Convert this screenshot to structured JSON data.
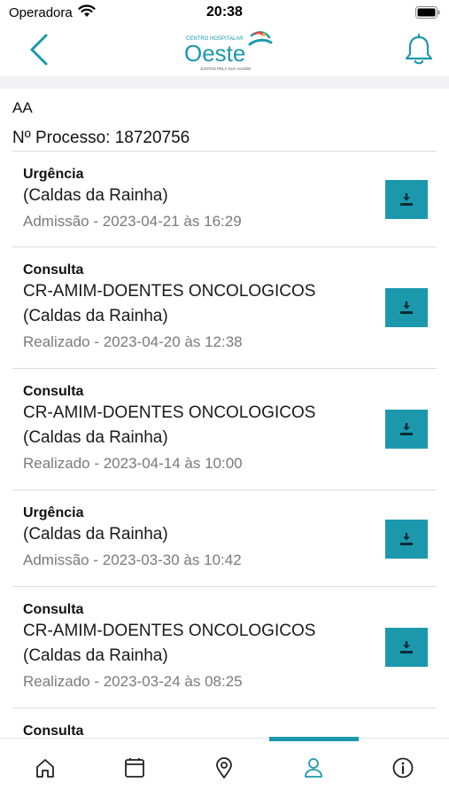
{
  "status_bar": {
    "carrier": "Operadora",
    "time": "20:38"
  },
  "header": {
    "logo": {
      "top_text": "CENTRO HOSPITALAR",
      "name": "Oeste",
      "tagline": "JUNTOS PELA SUA SAÚDE"
    },
    "back_icon": "chevron-left-icon",
    "notification_icon": "bell-icon"
  },
  "patient": {
    "name": "AA",
    "process": "Nº Processo: 18720756"
  },
  "episodes": [
    {
      "type": "Urgência",
      "lines": [
        "(Caldas da Rainha)"
      ],
      "meta": "Admissão - 2023-04-21 às 16:29"
    },
    {
      "type": "Consulta",
      "lines": [
        "CR-AMIM-DOENTES ONCOLOGICOS",
        "(Caldas da Rainha)"
      ],
      "meta": "Realizado - 2023-04-20 às 12:38"
    },
    {
      "type": "Consulta",
      "lines": [
        "CR-AMIM-DOENTES ONCOLOGICOS",
        "(Caldas da Rainha)"
      ],
      "meta": "Realizado - 2023-04-14 às 10:00"
    },
    {
      "type": "Urgência",
      "lines": [
        "(Caldas da Rainha)"
      ],
      "meta": "Admissão - 2023-03-30 às 10:42"
    },
    {
      "type": "Consulta",
      "lines": [
        "CR-AMIM-DOENTES ONCOLOGICOS",
        "(Caldas da Rainha)"
      ],
      "meta": "Realizado - 2023-03-24 às 08:25"
    },
    {
      "type": "Consulta",
      "lines": [],
      "meta": ""
    }
  ],
  "tabs": [
    {
      "icon": "home-icon",
      "active": false
    },
    {
      "icon": "calendar-icon",
      "active": false
    },
    {
      "icon": "location-pin-icon",
      "active": false
    },
    {
      "icon": "person-icon",
      "active": true
    },
    {
      "icon": "info-icon",
      "active": false
    }
  ],
  "colors": {
    "accent": "#1c98ad",
    "muted_text": "#7a7a7a",
    "divider": "#dcdcdc"
  }
}
